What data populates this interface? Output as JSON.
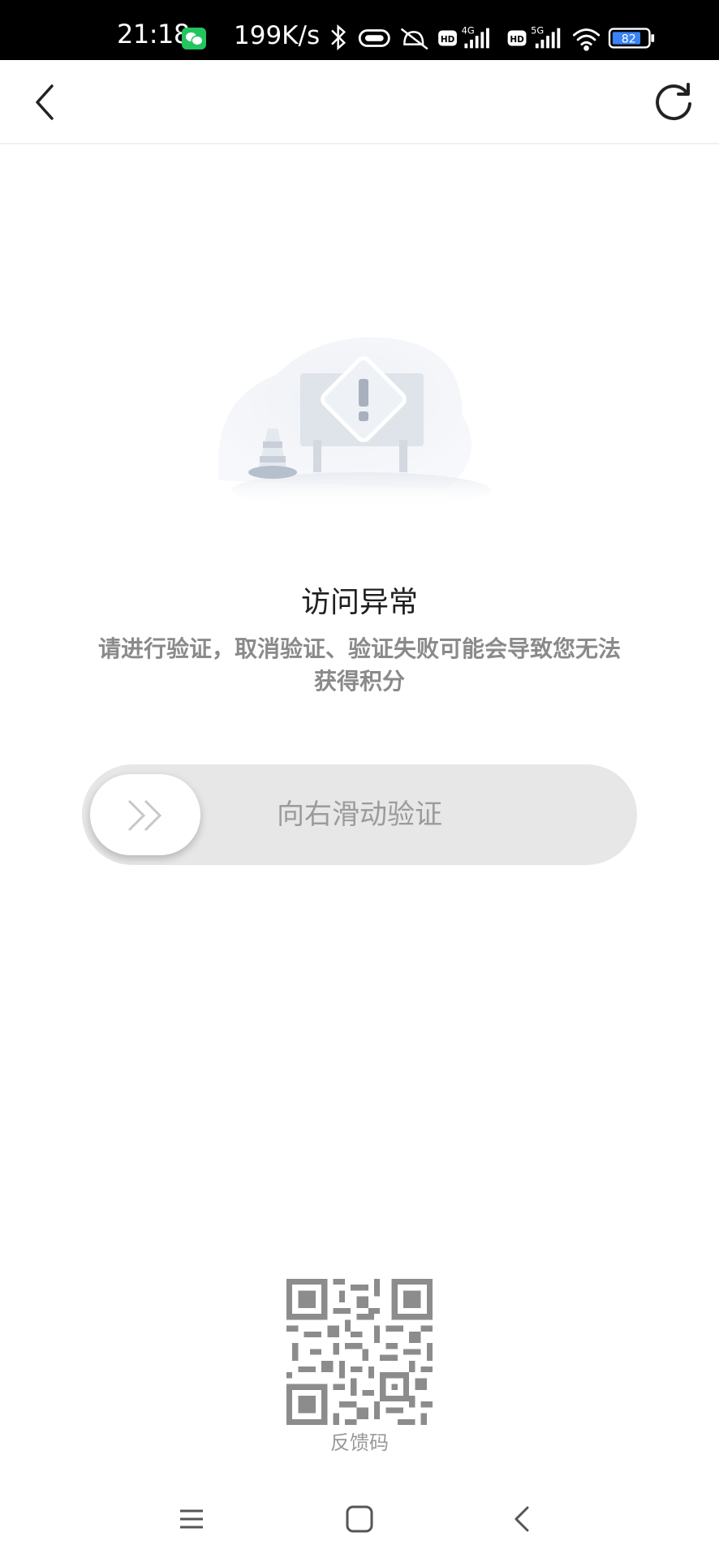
{
  "status_bar": {
    "time": "21:18",
    "network_speed": "199K/s",
    "battery_level": "82",
    "signal_1_type": "4G",
    "signal_2_type": "5G",
    "hd_label": "HD"
  },
  "header": {
    "back_icon": "chevron-left-icon",
    "refresh_icon": "refresh-icon"
  },
  "main": {
    "title": "访问异常",
    "description": "请进行验证，取消验证、验证失败可能会导致您无法获得积分",
    "slider_label": "向右滑动验证"
  },
  "feedback": {
    "label": "反馈码"
  },
  "nav": {
    "menu_icon": "menu-icon",
    "home_icon": "home-square-icon",
    "back_icon": "back-chevron-icon"
  },
  "colors": {
    "slider_track": "#e7e7e7",
    "text_muted": "#8a8a8a"
  }
}
